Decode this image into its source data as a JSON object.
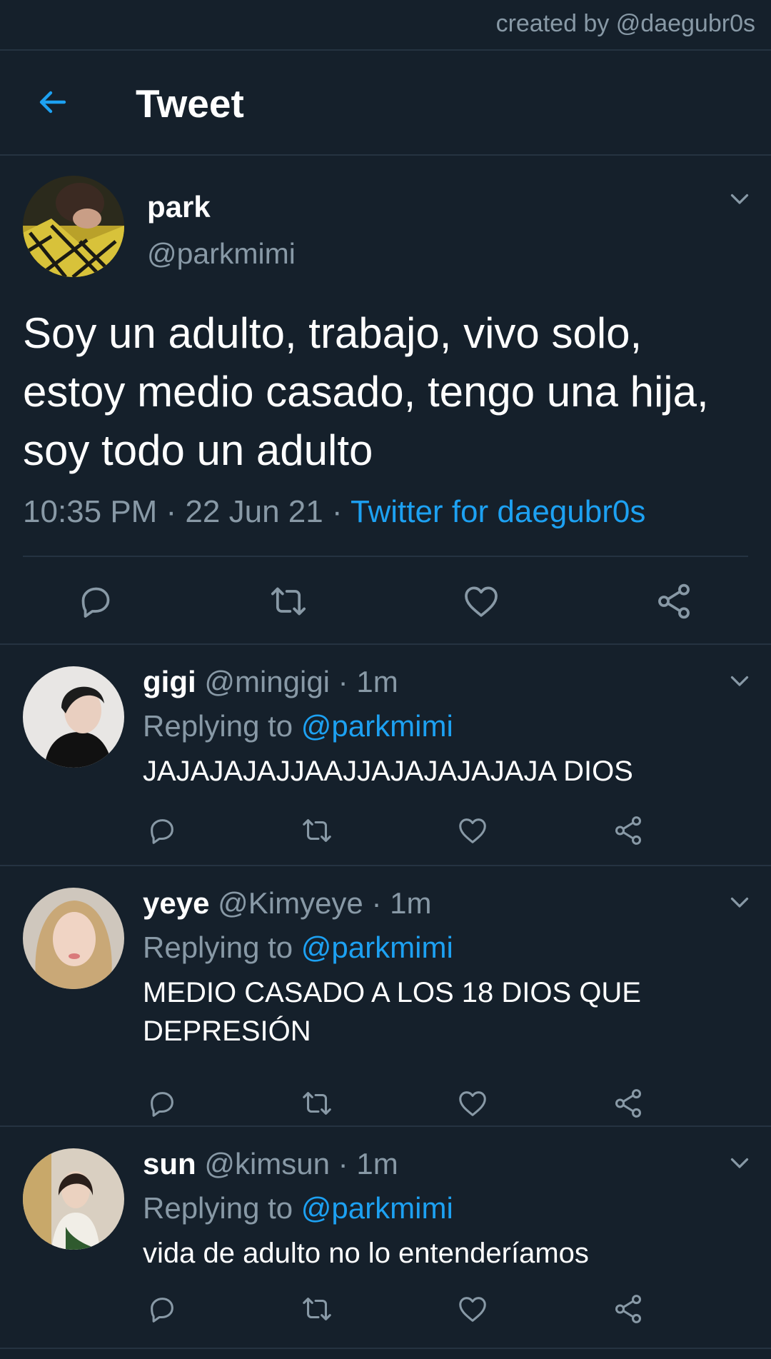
{
  "watermark": "created by @daegubr0s",
  "header": {
    "title": "Tweet"
  },
  "main_tweet": {
    "name": "park",
    "handle": "@parkmimi",
    "text": "Soy un adulto, trabajo, vivo solo, estoy medio casado, tengo una hija, soy todo un adulto",
    "time_date": "10:35 PM · 22 Jun 21 · ",
    "source": "Twitter for daegubr0s"
  },
  "replies": [
    {
      "name": "gigi",
      "handle_time": " @mingigi · 1m",
      "replying_prefix": "Replying to ",
      "replying_to": "@parkmimi",
      "text": "JAJAJAJAJJAAJJAJAJAJAJAJA DIOS"
    },
    {
      "name": "yeye",
      "handle_time": " @Kimyeye · 1m",
      "replying_prefix": "Replying to ",
      "replying_to": "@parkmimi",
      "text": "MEDIO CASADO A LOS 18 DIOS QUE DEPRESIÓN"
    },
    {
      "name": "sun",
      "handle_time": " @kimsun · 1m",
      "replying_prefix": "Replying to ",
      "replying_to": "@parkmimi",
      "text": "vida de adulto no lo entenderíamos"
    }
  ],
  "icons": {
    "back": "arrow-left-icon",
    "menu": "chevron-down-icon",
    "reply": "reply-icon",
    "retweet": "retweet-icon",
    "like": "heart-icon",
    "share": "share-icon"
  },
  "colors": {
    "background": "#15202b",
    "accent": "#1da1f2",
    "muted": "#8899a6",
    "divider": "#253341"
  }
}
